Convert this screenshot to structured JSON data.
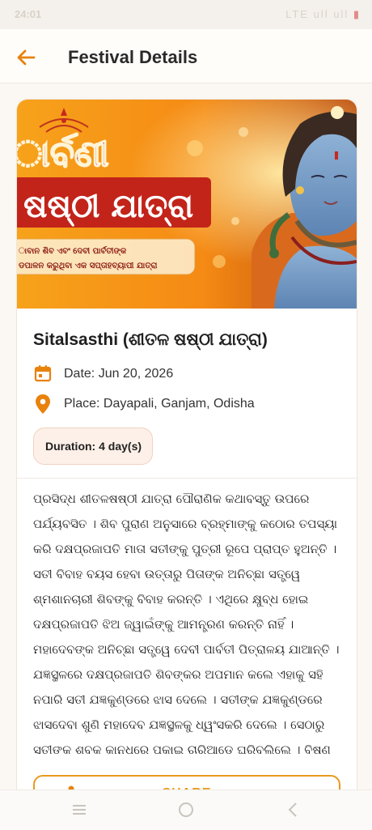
{
  "status_bar": {
    "time": "24:01",
    "indicators": "LTE ull ull"
  },
  "app_bar": {
    "title": "Festival Details",
    "back_icon": "arrow-left-icon",
    "accent_color": "#e8820c"
  },
  "banner": {
    "title_line1": "ାର୍ବଣୀ",
    "title_line2": "ଷଷ୍ଠୀ ଯାତ୍ରା",
    "caption_line1": "ାବାନ ଶିବ ଏବଂ ଦେବୀ ପାର୍ବତୀଙ୍କ",
    "caption_line2": "ଡପାଳନ କରୁଥିବା ଏକ ସପ୍ତାହବ୍ୟାପୀ ଯାତ୍ରା"
  },
  "festival": {
    "title": "Sitalsasthi (ଶୀତଳ ଷଷ୍ଠୀ ଯାତ୍ରା)",
    "date": "Date: Jun 20, 2026",
    "place": "Place: Dayapali, Ganjam, Odisha",
    "duration": "Duration: 4 day(s)",
    "description": "ପ୍ରସିଦ୍ଧ ଶୀତଳଷଷ୍ଠୀ ଯାତ୍ରା ପୌରାଣିକ କଥାବସ୍ତୁ ଉପରେ ପର୍ଯ୍ୟବସିତ । ଶିବ ପୁରାଣ ଅନୁସାରେ ବ୍ରହ୍ମାଙ୍କୁ କଠୋର ତପସ୍ୟା କରି ଦକ୍ଷପ୍ରଜାପତି ମାତା ସତୀଙ୍କୁ ପୁତ୍ରୀ ରୂପେ ପ୍ରାପ୍ତ ହୁଅନ୍ତି । ସତୀ ବିବାହ ବୟସ ହେବା ଉତ୍ତାରୁ ପିତାଙ୍କ ଅନିଚ୍ଛା ସତ୍ତ୍ୱେ ଶ୍ମଶାନଚାରୀ ଶିବଙ୍କୁ ବିବାହ କରନ୍ତି । ଏଥିରେ କ୍ଷୁବ୍ଧ ହୋଇ ଦକ୍ଷପ୍ରଜାପତି ଝିଅ ଜ୍ୱାଇଁଙ୍କୁ ଆମନ୍ତ୍ରଣ କରନ୍ତି ନାହିଁ । ମହାଦେବଙ୍କ ଅନିଚ୍ଛା ସତ୍ତ୍ୱେ ଦେବୀ ପାର୍ବତୀ ପିତ୍ରାଳୟ ଯାଆନ୍ତି । ଯଜ୍ଞସ୍ଥଳରେ ଦକ୍ଷପ୍ରଜାପତି ଶିବଙ୍କର ଅପମାନ କଲେ ଏହାକୁ ସହି ନପାରି ସତୀ ଯଜ୍ଞକୁଣ୍ଡରେ ଝାସ ଦେଲେ । ସତୀଙ୍କ ଯଜ୍ଞକୁଣ୍ଡରେ ଝାସଦେବା ଶୁଣି ମହାଦେବ ଯଜ୍ଞସ୍ଥଳକୁ ଧ୍ୱଂସକରି ଦେଲେ । ସେଠାରୁ ସତୀଙ୍କ ଶବକୁ କାନ୍ଧରେ ପକାଇ ଚାରିଆଡେ ଘୁରିବୁଲିଲେ । ବିଷ୍ଣୁ ଚକ୍ରଦ୍ୱାରା ସତୀଙ୍କ ଶରୀରକୁ ଖଣ୍ଡ ଖଣ୍ଡ କରି ଶିବଙ୍କଠାରୁ ଅଲଗା କରିଦେଲେ ।"
  },
  "share": {
    "label": "SHARE",
    "icon": "share-icon"
  },
  "nav": {
    "menu_icon": "menu-icon",
    "home_icon": "home-circle-icon",
    "back_icon": "back-triangle-icon"
  }
}
